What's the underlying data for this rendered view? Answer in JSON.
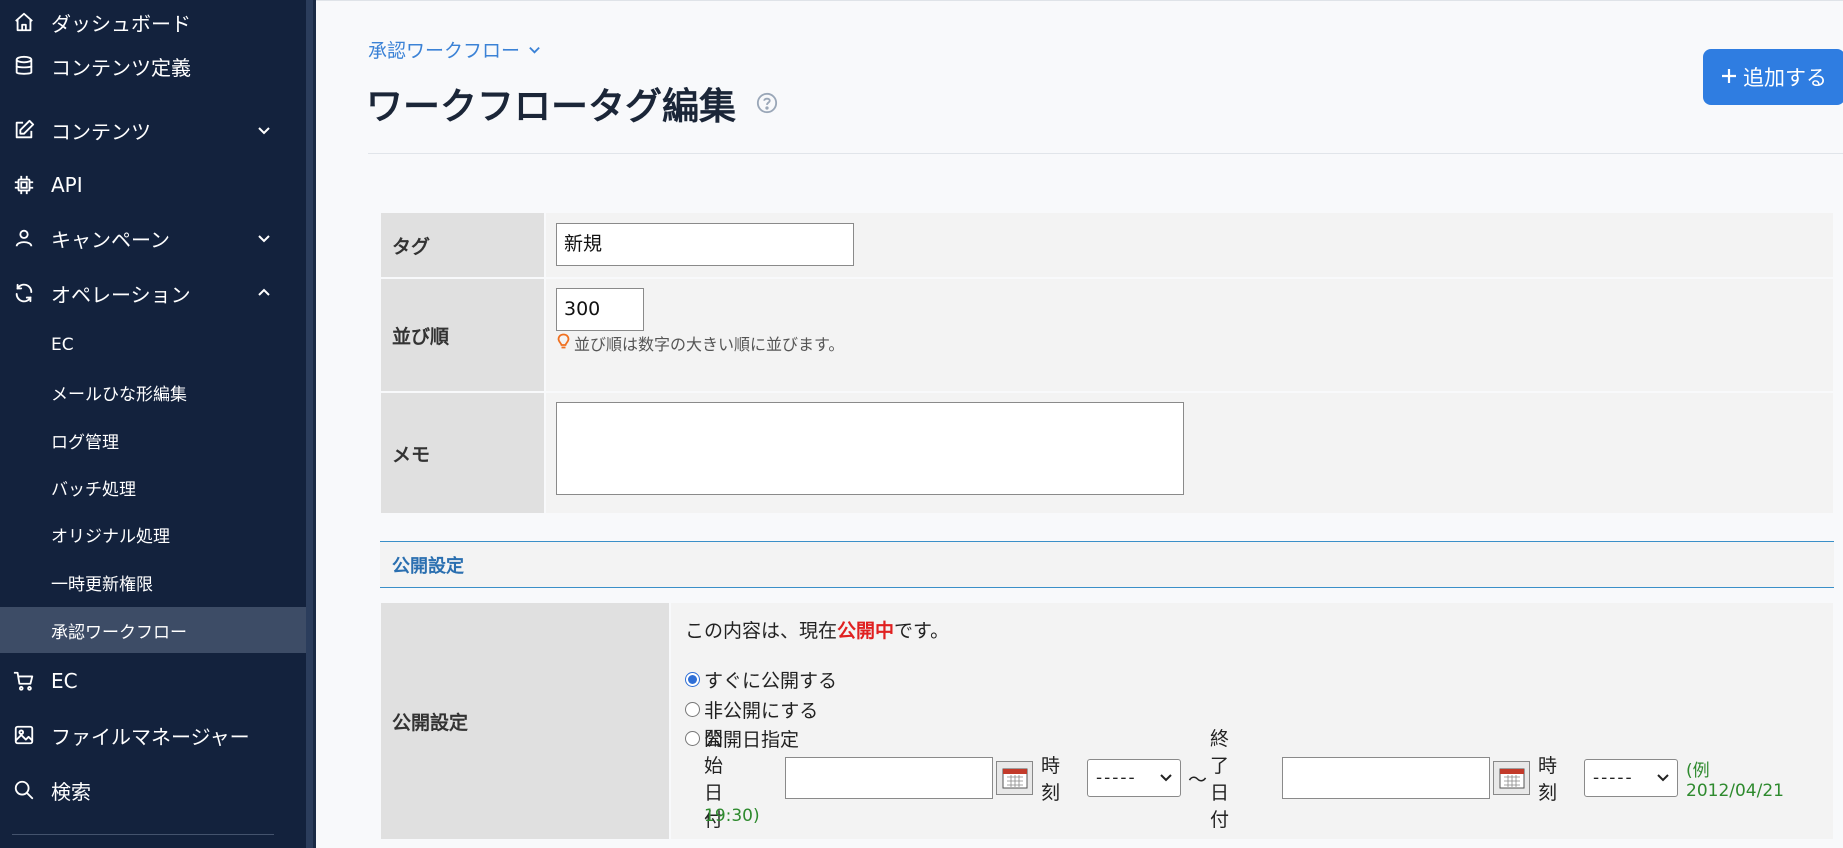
{
  "sidebar": {
    "items": [
      {
        "label": "ダッシュボード",
        "icon": "home-icon"
      },
      {
        "label": "コンテンツ定義",
        "icon": "database-icon"
      },
      {
        "label": "コンテンツ",
        "icon": "edit-icon",
        "chevron": "down"
      },
      {
        "label": "API",
        "icon": "chip-icon"
      },
      {
        "label": "キャンペーン",
        "icon": "user-icon",
        "chevron": "down"
      },
      {
        "label": "オペレーション",
        "icon": "refresh-icon",
        "chevron": "up"
      }
    ],
    "subitems": [
      {
        "label": "EC"
      },
      {
        "label": "メールひな形編集"
      },
      {
        "label": "ログ管理"
      },
      {
        "label": "バッチ処理"
      },
      {
        "label": "オリジナル処理"
      },
      {
        "label": "一時更新権限"
      },
      {
        "label": "承認ワークフロー",
        "active": true
      }
    ],
    "bottom_items": [
      {
        "label": "EC",
        "icon": "cart-icon"
      },
      {
        "label": "ファイルマネージャー",
        "icon": "image-icon"
      },
      {
        "label": "検索",
        "icon": "search-icon"
      }
    ]
  },
  "header": {
    "breadcrumb": "承認ワークフロー",
    "title": "ワークフロータグ編集",
    "add_button": "追加する"
  },
  "form": {
    "tag": {
      "label": "タグ",
      "value": "新規"
    },
    "sort": {
      "label": "並び順",
      "value": "300",
      "hint": "並び順は数字の大きい順に並びます。"
    },
    "memo": {
      "label": "メモ",
      "value": ""
    }
  },
  "publish": {
    "section_title": "公開設定",
    "row_label": "公開設定",
    "status_prefix": "この内容は、現在",
    "status_highlight": "公開中",
    "status_suffix": "です。",
    "options": [
      {
        "label": "すぐに公開する",
        "checked": true
      },
      {
        "label": "非公開にする",
        "checked": false
      },
      {
        "label": "公開日指定",
        "checked": false
      }
    ],
    "start_label": "開始日付",
    "time_label": "時刻",
    "time_placeholder": "-----",
    "range_sep": "〜",
    "end_label": "終了日付",
    "time_label2": "時刻",
    "example_line1": "(例 2012/04/21",
    "example_line2": "19:30)"
  },
  "colors": {
    "sidebar_bg": "#13223d",
    "accent": "#2f7de1",
    "highlight_red": "#e02020",
    "example_green": "#2e8a2e"
  }
}
